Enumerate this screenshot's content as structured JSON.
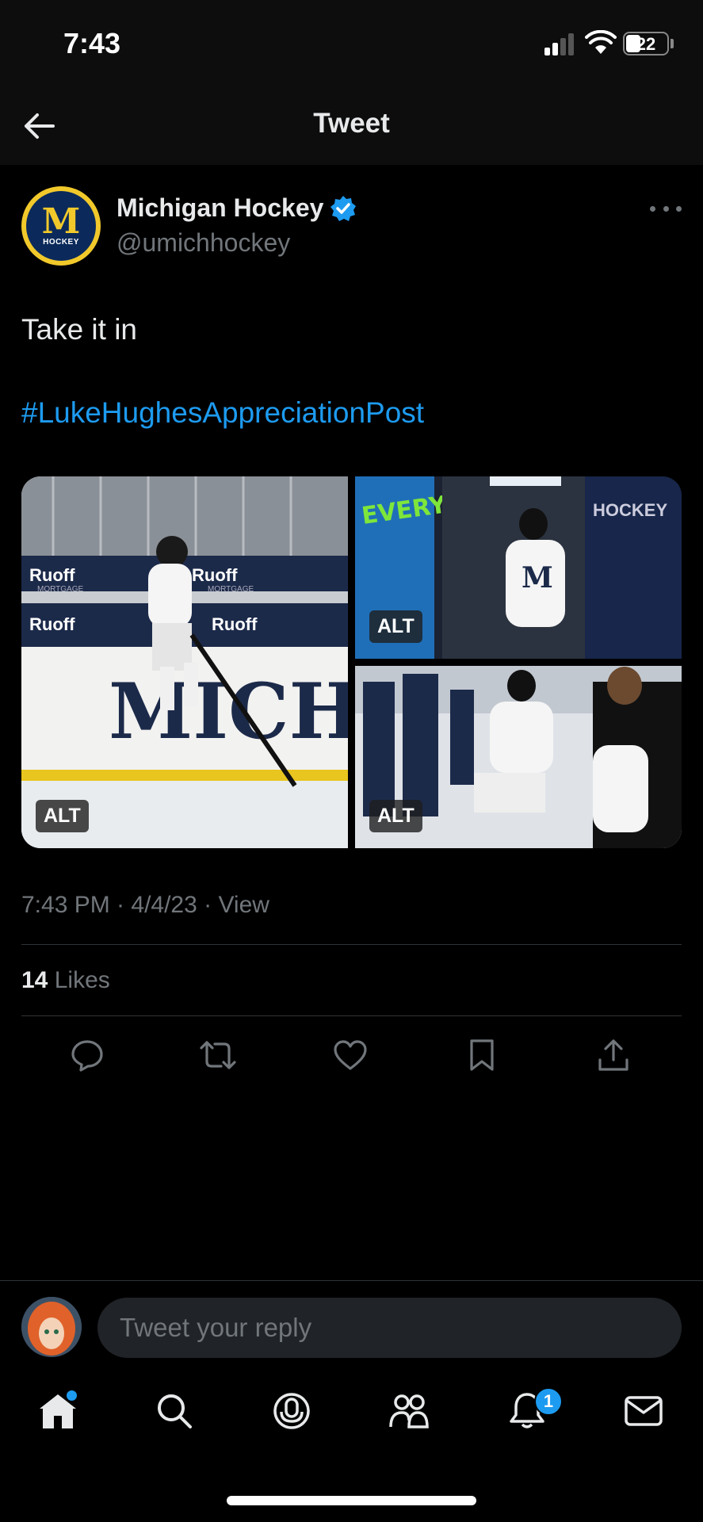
{
  "status_bar": {
    "time": "7:43",
    "battery": "22"
  },
  "header": {
    "title": "Tweet",
    "back_icon": "arrow-left-icon"
  },
  "tweet": {
    "author": {
      "display_name": "Michigan Hockey",
      "handle": "@umichhockey",
      "avatar_letter": "M",
      "avatar_label": "HOCKEY",
      "verified": true
    },
    "text": "Take it in",
    "hashtag": "#LukeHughesAppreciationPost",
    "media": [
      {
        "alt_badge": "ALT",
        "banner_1": "Ruoff",
        "banner_2": "MORTGAGE",
        "board_text": "MICHIGA"
      },
      {
        "alt_badge": "ALT",
        "mural": "EVERY SHIFT MATTERS",
        "wall_text": "HOCKEY"
      },
      {
        "alt_badge": "ALT"
      }
    ],
    "timestamp": "7:43 PM · 4/4/23 · View",
    "likes_count": "14",
    "likes_label": "Likes"
  },
  "actions": [
    "reply-icon",
    "retweet-icon",
    "like-icon",
    "bookmark-icon",
    "share-icon"
  ],
  "reply": {
    "placeholder": "Tweet your reply"
  },
  "tabbar": {
    "items": [
      "home-icon",
      "search-icon",
      "spaces-icon",
      "communities-icon",
      "notifications-icon",
      "messages-icon"
    ],
    "notification_count": "1"
  },
  "colors": {
    "accent": "#1d9bf0",
    "background": "#000000",
    "muted": "#71767b",
    "text": "#e7e9ea"
  }
}
